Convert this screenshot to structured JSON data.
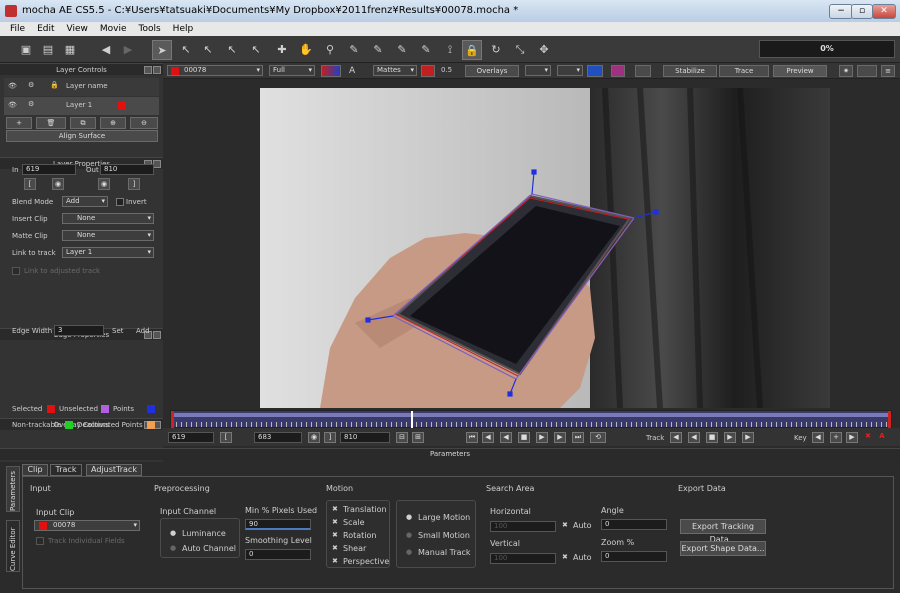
{
  "window": {
    "title": "mocha AE CS5.5 - C:¥Users¥tatsuaki¥Documents¥My Dropbox¥2011frenz¥Results¥00078.mocha *",
    "btn_min": "−",
    "btn_max": "▫",
    "btn_close": "✕"
  },
  "menu": [
    "File",
    "Edit",
    "View",
    "Movie",
    "Tools",
    "Help"
  ],
  "progress": {
    "label": "0%",
    "value": 0
  },
  "viewer_bar": {
    "clip": "00078",
    "view": "Full",
    "mattes": "Mattes",
    "opacity": "0.5",
    "overlays": "Overlays",
    "stabilize": "Stabilize",
    "trace": "Trace",
    "preview": "Preview",
    "text_tool": "A"
  },
  "layer_controls": {
    "title": "Layer Controls",
    "col_name": "Layer name",
    "layer_name": "Layer 1",
    "align_surface": "Align Surface",
    "layer_color": "#e01010"
  },
  "layer_properties": {
    "title": "Layer Properties",
    "in_label": "In",
    "in_value": "619",
    "out_label": "Out",
    "out_value": "810",
    "blend_label": "Blend Mode",
    "blend_value": "Add",
    "invert": "Invert",
    "insert_clip_label": "Insert Clip",
    "insert_clip_value": "None",
    "matte_clip_label": "Matte Clip",
    "matte_clip_value": "None",
    "link_label": "Link to track",
    "link_value": "Layer 1",
    "link_adjusted": "Link to adjusted track"
  },
  "edge_properties": {
    "title": "Edge Properties",
    "edge_width_label": "Edge Width",
    "edge_width_value": "3",
    "set": "Set",
    "add": "Add"
  },
  "overlay_colours": {
    "title": "Overlay Colours",
    "selected": "Selected",
    "unselected": "Unselected",
    "points": "Points",
    "nontrackable": "Non-trackable",
    "deactivated": "Deactivated Points",
    "c_selected": "#e01010",
    "c_unselected": "#b060e0",
    "c_points": "#2030e0",
    "c_nontrackable": "#20d020",
    "c_deactivated": "#f0a050"
  },
  "timeline": {
    "in": "619",
    "current": "683",
    "out": "810",
    "track_label": "Track",
    "key_label": "Key"
  },
  "params": {
    "header": "Parameters",
    "side_tabs": {
      "parameters": "Parameters",
      "curve_editor": "Curve Editor"
    },
    "tabs": [
      "Clip",
      "Track",
      "AdjustTrack"
    ],
    "input": {
      "title": "Input",
      "clip_label": "Input Clip",
      "clip_value": "00078",
      "track_fields": "Track Individual Fields"
    },
    "preprocessing": {
      "title": "Preprocessing",
      "channel_label": "Input Channel",
      "luminance": "Luminance",
      "auto_channel": "Auto Channel",
      "min_pixels_label": "Min % Pixels Used",
      "min_pixels_value": "90",
      "smoothing_label": "Smoothing Level",
      "smoothing_value": "0"
    },
    "motion": {
      "title": "Motion",
      "translation": "Translation",
      "scale": "Scale",
      "rotation": "Rotation",
      "shear": "Shear",
      "perspective": "Perspective",
      "large": "Large Motion",
      "small": "Small Motion",
      "manual": "Manual Track"
    },
    "search": {
      "title": "Search Area",
      "horizontal": "Horizontal",
      "h_value": "100",
      "vertical": "Vertical",
      "v_value": "100",
      "auto": "Auto",
      "angle_label": "Angle",
      "angle_value": "0",
      "zoom_label": "Zoom %",
      "zoom_value": "0"
    },
    "export": {
      "title": "Export Data",
      "tracking": "Export Tracking Data...",
      "shape": "Export Shape Data..."
    }
  }
}
